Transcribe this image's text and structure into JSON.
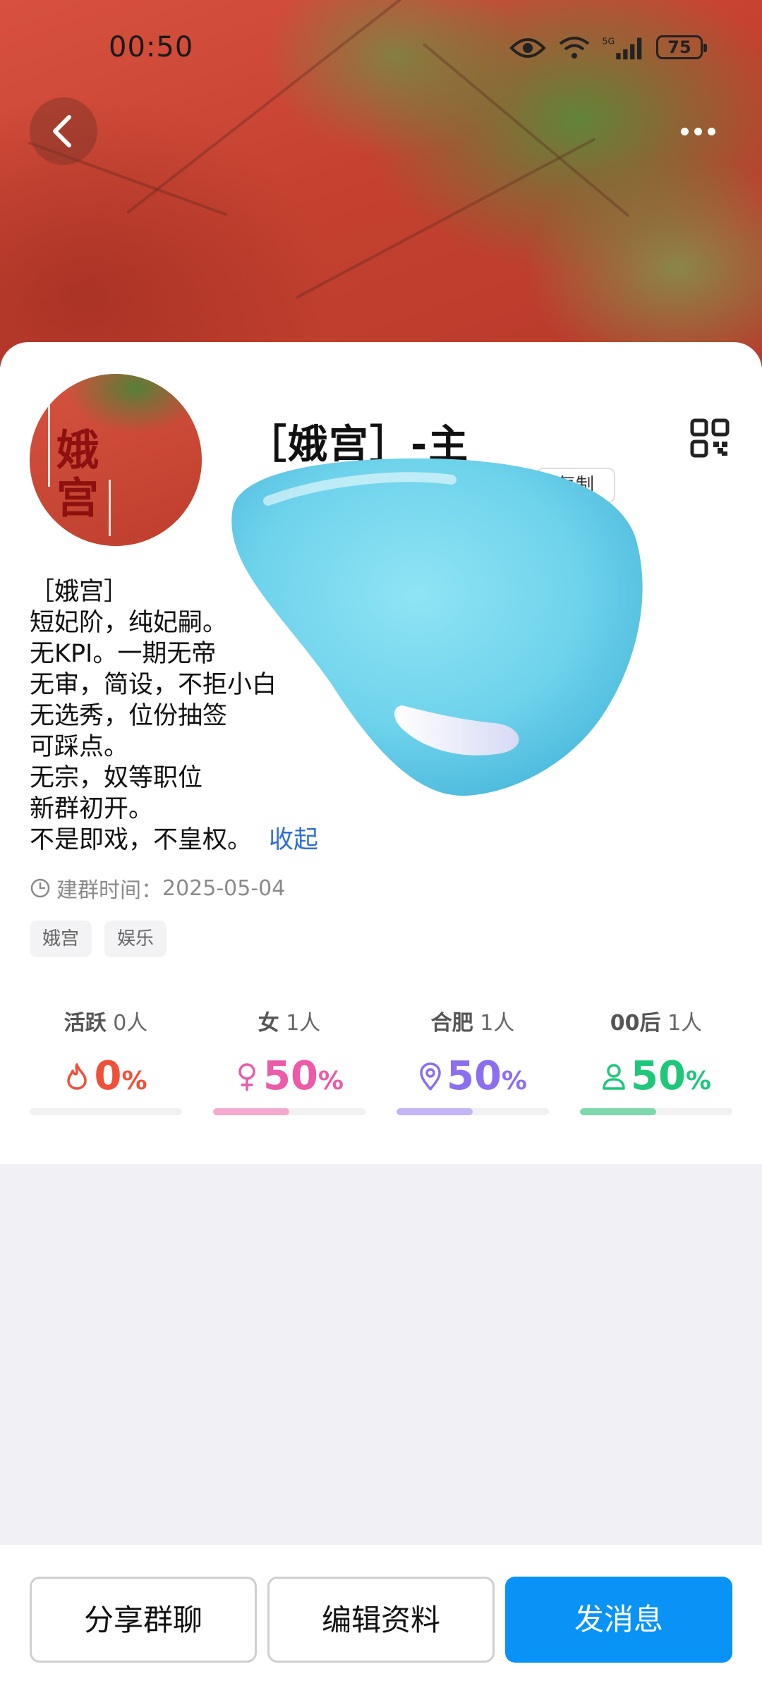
{
  "status_bar": {
    "time": "00:50",
    "battery": "75"
  },
  "header": {
    "back_icon": "chevron-left-icon",
    "more_icon": "more-horizontal-icon"
  },
  "group": {
    "avatar_text": [
      "娥",
      "宫"
    ],
    "name": "［娥宫］-主",
    "copy_label": "复制",
    "description_lines": [
      "［娥宫］",
      "短妃阶，纯妃嗣。",
      "无KPI。一期无帝",
      "无审，简设，不拒小白",
      "无选秀，位份抽签",
      "可踩点。",
      "无宗，奴等职位",
      "新群初开。",
      "不是即戏，不皇权。"
    ],
    "collapse_label": "收起",
    "created_label": "建群时间：",
    "created_date": "2025-05-04",
    "tags": [
      "娥宫",
      "娱乐"
    ]
  },
  "stats": [
    {
      "label": "活跃",
      "count": "0人",
      "value": "0",
      "unit": "%",
      "percent": 0,
      "color": "#f0503a",
      "icon": "fire-icon"
    },
    {
      "label": "女",
      "count": "1人",
      "value": "50",
      "unit": "%",
      "percent": 50,
      "color": "#ec5aa8",
      "icon": "female-icon"
    },
    {
      "label": "合肥",
      "count": "1人",
      "value": "50",
      "unit": "%",
      "percent": 50,
      "color": "#8c6ff0",
      "icon": "location-pin-icon"
    },
    {
      "label": "00后",
      "count": "1人",
      "value": "50",
      "unit": "%",
      "percent": 50,
      "color": "#1fc77a",
      "icon": "person-icon"
    }
  ],
  "actions": {
    "share_label": "分享群聊",
    "edit_label": "编辑资料",
    "message_label": "发消息"
  },
  "colors": {
    "primary": "#0a93f7",
    "link": "#2f6fd6"
  }
}
